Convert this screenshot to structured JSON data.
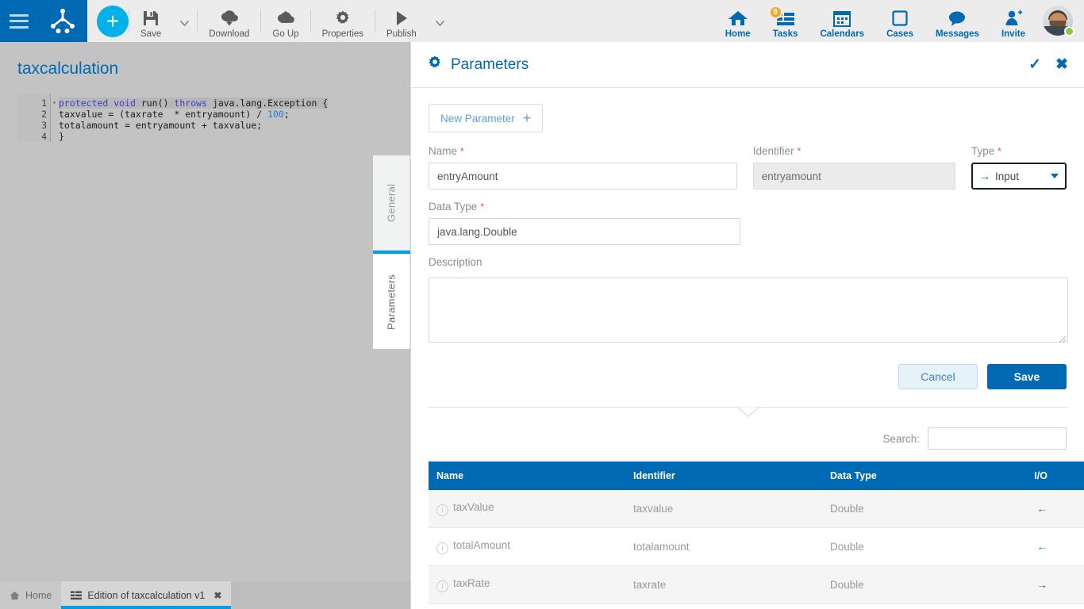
{
  "topbar": {
    "menu_icon": "hamburger-icon",
    "logo_icon": "bonita-frog-logo",
    "add_label": "+",
    "items": [
      {
        "label": "Save",
        "icon": "floppy-disk-icon"
      },
      {
        "label": "Download",
        "icon": "download-cloud-icon"
      },
      {
        "label": "Go Up",
        "icon": "upload-cloud-icon"
      },
      {
        "label": "Properties",
        "icon": "gear-icon"
      },
      {
        "label": "Publish",
        "icon": "play-triangle-icon"
      }
    ],
    "right_items": [
      {
        "label": "Home",
        "icon": "house-icon",
        "badge": ""
      },
      {
        "label": "Tasks",
        "icon": "task-list-icon",
        "badge": "9"
      },
      {
        "label": "Calendars",
        "icon": "calendar-icon",
        "badge": ""
      },
      {
        "label": "Cases",
        "icon": "square-outline-icon",
        "badge": ""
      },
      {
        "label": "Messages",
        "icon": "speech-bubble-icon",
        "badge": ""
      },
      {
        "label": "Invite",
        "icon": "person-plus-icon",
        "badge": ""
      }
    ],
    "avatar_name": "user-avatar",
    "avatar_status": "online"
  },
  "editor": {
    "title": "taxcalculation",
    "status_color": "#8cc63f",
    "lines": [
      {
        "n": "1",
        "fold": true
      },
      {
        "n": "2",
        "fold": false
      },
      {
        "n": "3",
        "fold": false
      },
      {
        "n": "4",
        "fold": false
      }
    ],
    "code": {
      "l1_a": "protected",
      "l1_b": "void",
      "l1_c": " run() ",
      "l1_d": "throws",
      "l1_e": " java.lang.Exception {",
      "l2_a": "taxvalue = (taxrate  * entryamount) / ",
      "l2_b": "100",
      "l2_c": ";",
      "l3": "totalamount = entryamount + taxvalue;",
      "l4": "}"
    }
  },
  "vtabs": {
    "general": "General",
    "parameters": "Parameters",
    "selected": "General"
  },
  "panel": {
    "title": "Parameters",
    "gear_icon": "gear-icon",
    "confirm_icon": "check-icon",
    "close_icon": "close-icon",
    "new_parameter_label": "New Parameter",
    "new_parameter_plus": "+"
  },
  "form": {
    "name_label": "Name",
    "name_value": "entryAmount",
    "identifier_label": "Identifier",
    "identifier_value": "entryamount",
    "type_label": "Type",
    "type_value": "Input",
    "type_arrow": "→",
    "data_type_label": "Data Type",
    "data_type_value": "java.lang.Double",
    "description_label": "Description",
    "description_value": "",
    "required_mark": "*",
    "cancel_label": "Cancel",
    "save_label": "Save"
  },
  "search": {
    "label": "Search:",
    "value": "",
    "placeholder": ""
  },
  "table": {
    "headers": [
      "Name",
      "Identifier",
      "Data Type",
      "I/O"
    ],
    "rows": [
      {
        "name": "taxValue",
        "identifier": "taxvalue",
        "data_type": "Double",
        "io": "←",
        "io_kind": "output"
      },
      {
        "name": "totalAmount",
        "identifier": "totalamount",
        "data_type": "Double",
        "io": "←",
        "io_kind": "output"
      },
      {
        "name": "taxRate",
        "identifier": "taxrate",
        "data_type": "Double",
        "io": "→",
        "io_kind": "input"
      }
    ]
  },
  "taskbar": {
    "home_label": "Home",
    "edition_label": "Edition of taxcalculation v1",
    "close_glyph": "✖"
  },
  "colors": {
    "brand_blue": "#0069b4",
    "accent_cyan": "#00a0e3",
    "status_green": "#8cc63f",
    "badge_orange": "#f5a623",
    "required_red": "#e8603c"
  }
}
